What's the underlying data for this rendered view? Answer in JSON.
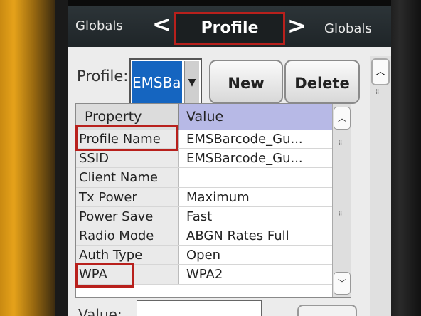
{
  "header": {
    "left_label": "Globals",
    "title": "Profile",
    "right_label": "Globals",
    "prev_glyph": "<",
    "next_glyph": ">"
  },
  "profile_bar": {
    "label": "Profile:",
    "selected_value": "EMSBar",
    "dropdown_glyph": "▼",
    "new_button": "New",
    "delete_button": "Delete"
  },
  "grid": {
    "columns": [
      "Property",
      "Value"
    ],
    "rows": [
      {
        "property": "Profile Name",
        "value": "EMSBarcode_Gu..."
      },
      {
        "property": "SSID",
        "value": "EMSBarcode_Gu..."
      },
      {
        "property": "Client Name",
        "value": ""
      },
      {
        "property": "Tx Power",
        "value": "Maximum"
      },
      {
        "property": "Power Save",
        "value": "Fast"
      },
      {
        "property": "Radio Mode",
        "value": "ABGN Rates Full"
      },
      {
        "property": "Auth Type",
        "value": "Open"
      },
      {
        "property": "WPA",
        "value": "WPA2"
      }
    ],
    "scroll_up_glyph": "︿",
    "scroll_down_glyph": "﹀"
  },
  "editor": {
    "value_label": "Value:"
  },
  "colors": {
    "highlight": "#b8201c",
    "selection": "#1565c0",
    "value_header": "#b7b9e6"
  }
}
